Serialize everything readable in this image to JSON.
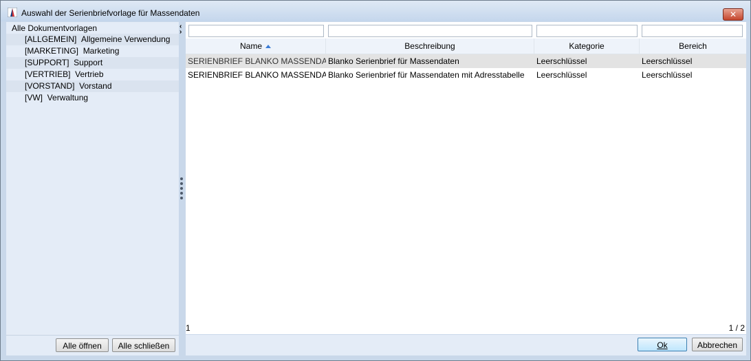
{
  "window": {
    "title": "Auswahl der Serienbriefvorlage für Massendaten",
    "close_label": "✕"
  },
  "tree": {
    "root": "Alle Dokumentvorlagen",
    "items": [
      {
        "code": "[ALLGEMEIN]",
        "label": "Allgemeine Verwendung"
      },
      {
        "code": "[MARKETING]",
        "label": "Marketing"
      },
      {
        "code": "[SUPPORT]",
        "label": "Support"
      },
      {
        "code": "[VERTRIEB]",
        "label": "Vertrieb"
      },
      {
        "code": "[VORSTAND]",
        "label": "Vorstand"
      },
      {
        "code": "[VW]",
        "label": "Verwaltung"
      }
    ],
    "expand_all": "Alle öffnen",
    "collapse_all": "Alle schließen"
  },
  "table": {
    "columns": [
      "Name",
      "Beschreibung",
      "Kategorie",
      "Bereich"
    ],
    "sort_column": "Name",
    "sort_direction": "ascending",
    "rows": [
      [
        "SERIENBRIEF BLANKO MASSENDAT…",
        "Blanko Serienbrief für Massendaten",
        "Leerschlüssel",
        "Leerschlüssel"
      ],
      [
        "SERIENBRIEF BLANKO MASSENDAT…",
        "Blanko Serienbrief für Massendaten mit Adresstabelle",
        "Leerschlüssel",
        "Leerschlüssel"
      ]
    ],
    "footer_left": "1",
    "footer_right": "1 / 2"
  },
  "buttons": {
    "ok": "Ok",
    "cancel": "Abbrechen"
  },
  "colors": {
    "window_bg": "#c9d8ea",
    "panel_bg": "#e4ecf7",
    "selected_row": "#e3e3e3",
    "sort_arrow": "#3a7bd5",
    "close_btn": "#c4452c"
  }
}
